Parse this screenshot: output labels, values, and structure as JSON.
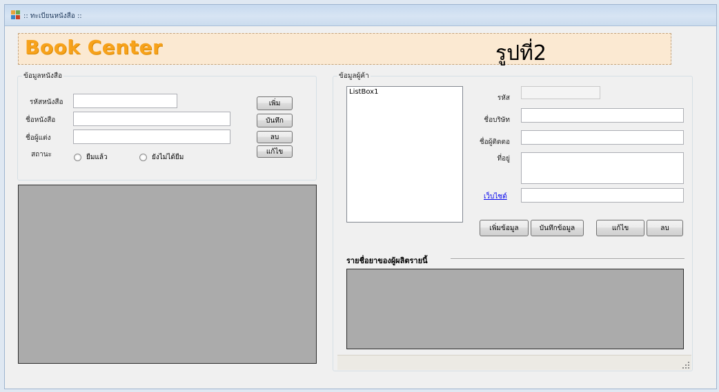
{
  "window": {
    "title": ":: ทะเบียนหนังสือ ::"
  },
  "banner": {
    "brand": "Book Center",
    "figure_label": "รูปที่2"
  },
  "book_panel": {
    "group_title": "ข้อมูลหนังสือ",
    "labels": {
      "book_id": "รหัสหนังสือ",
      "book_name": "ชื่อหนังสือ",
      "author": "ชื่อผู้แต่ง",
      "status": "สถานะ"
    },
    "values": {
      "book_id": "",
      "book_name": "",
      "author": ""
    },
    "radios": {
      "borrowed": "ยืมแล้ว",
      "not_borrowed": "ยังไม่ได้ยืม"
    },
    "buttons": {
      "add": "เพิ่ม",
      "save": "บันทึก",
      "delete": "ลบ",
      "edit": "แก้ไข"
    }
  },
  "supplier_panel": {
    "group_title": "ข้อมูลผู้ค้า",
    "listbox_item": "ListBox1",
    "labels": {
      "code": "รหัส",
      "company": "ชื่อบริษัท",
      "contact": "ชื่อผู้ติดตอ",
      "address": "ที่อยู่",
      "website": "เว็บไซต์"
    },
    "values": {
      "code": "",
      "company": "",
      "contact": "",
      "address": "",
      "website": ""
    },
    "buttons": {
      "add": "เพิ่มข้อมูล",
      "save": "บันทึกข้อมูล",
      "edit": "แก้ไข",
      "delete": "ลบ"
    },
    "products_title": "รายชื่อยาของผู้ผลิตรายนี้"
  },
  "colors": {
    "brand": "#f7a21b",
    "banner_bg": "#fbe9d2",
    "grid_bg": "#ababab",
    "link": "#0000ee"
  },
  "icons": {
    "title": "app-window-icon",
    "grip": "resize-grip-icon"
  }
}
